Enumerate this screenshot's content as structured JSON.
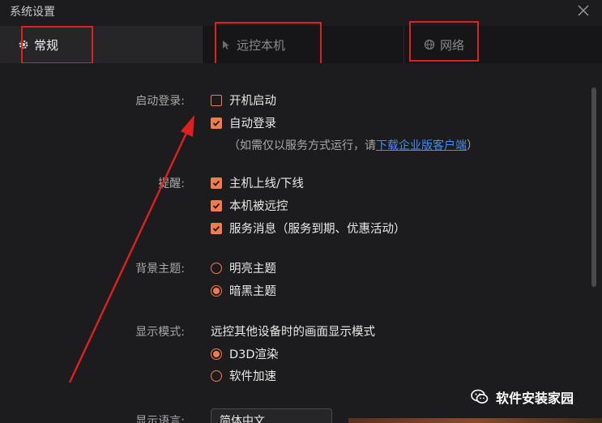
{
  "window": {
    "title": "系统设置"
  },
  "tabs": [
    {
      "label": "常规",
      "icon": "gear-icon"
    },
    {
      "label": "远控本机",
      "icon": "cursor-icon"
    },
    {
      "label": "网络",
      "icon": "globe-icon"
    }
  ],
  "sections": {
    "startup": {
      "label": "启动登录:",
      "options": [
        {
          "label": "开机启动",
          "checked": false
        },
        {
          "label": "自动登录",
          "checked": true
        }
      ],
      "hint_prefix": "（如需仅以服务方式运行，请",
      "hint_link": "下载企业版客户端",
      "hint_suffix": "）"
    },
    "reminder": {
      "label": "提醒:",
      "options": [
        {
          "label": "主机上线/下线",
          "checked": true
        },
        {
          "label": "本机被远控",
          "checked": true
        },
        {
          "label": "服务消息（服务到期、优惠活动）",
          "checked": true
        }
      ]
    },
    "theme": {
      "label": "背景主题:",
      "options": [
        {
          "label": "明亮主题",
          "selected": false
        },
        {
          "label": "暗黑主题",
          "selected": true
        }
      ]
    },
    "display": {
      "label": "显示模式:",
      "description": "远控其他设备时的画面显示模式",
      "options": [
        {
          "label": "D3D渲染",
          "selected": true
        },
        {
          "label": "软件加速",
          "selected": false
        }
      ]
    },
    "language": {
      "label": "显示语言:",
      "value": "简体中文"
    }
  },
  "watermark": {
    "text": "软件安装家园"
  },
  "colors": {
    "accent": "#f07b4c",
    "link": "#3e8ef7",
    "annotation": "#e02020",
    "background": "#1c1c1e"
  }
}
